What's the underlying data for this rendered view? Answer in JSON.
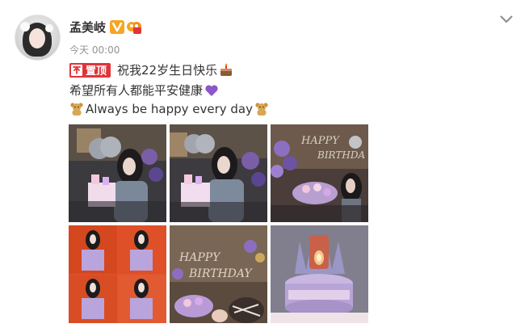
{
  "user": {
    "name": "孟美岐",
    "timestamp": "今天 00:00"
  },
  "post": {
    "pin_label": "置顶",
    "line1_text": "祝我22岁生日快乐",
    "line2_text": "希望所有人都能平安健康",
    "line3_text": "Always be happy every day"
  },
  "photos": [
    {
      "label": "photo-1"
    },
    {
      "label": "photo-2"
    },
    {
      "label": "photo-3"
    },
    {
      "label": "photo-4"
    },
    {
      "label": "photo-5"
    },
    {
      "label": "photo-6"
    }
  ],
  "colors": {
    "pin_red": "#e0343a",
    "vip_orange": "#f5a623",
    "text": "#333333",
    "muted": "#939393"
  },
  "icons": [
    "vip-verified-icon",
    "member-icon",
    "chevron-down-icon",
    "cake-emoji-icon",
    "purple-heart-emoji-icon",
    "bear-emoji-icon"
  ]
}
